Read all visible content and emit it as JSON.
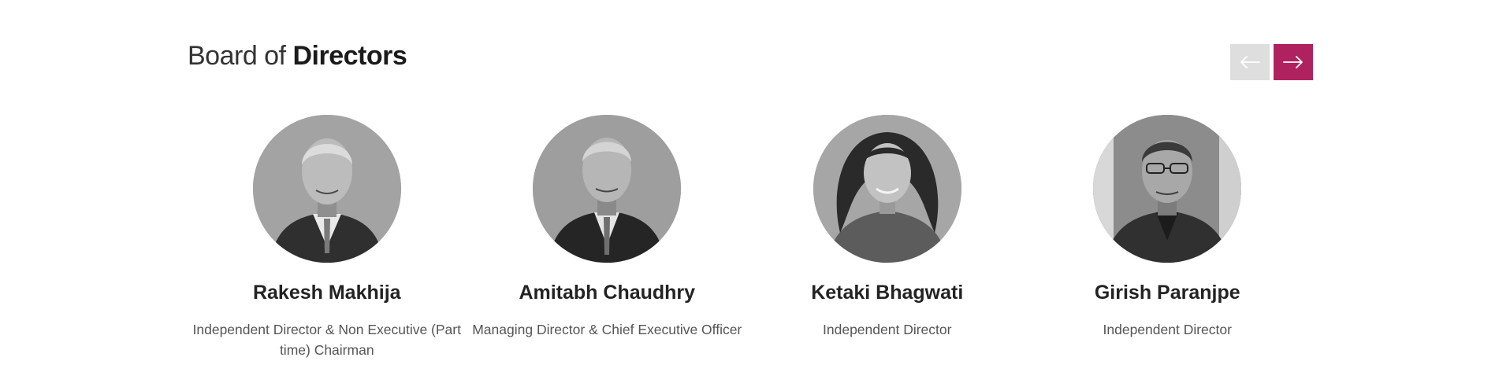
{
  "section": {
    "title_light": "Board of",
    "title_bold": "Directors"
  },
  "nav": {
    "prev_icon": "arrow-left-icon",
    "next_icon": "arrow-right-icon",
    "prev_color": "#dedede",
    "next_color": "#b0225f"
  },
  "directors": [
    {
      "name": "Rakesh Makhija",
      "role": "Independent Director & Non Executive (Part time) Chairman"
    },
    {
      "name": "Amitabh Chaudhry",
      "role": "Managing Director & Chief Executive Officer"
    },
    {
      "name": "Ketaki Bhagwati",
      "role": "Independent Director"
    },
    {
      "name": "Girish Paranjpe",
      "role": "Independent Director"
    }
  ]
}
